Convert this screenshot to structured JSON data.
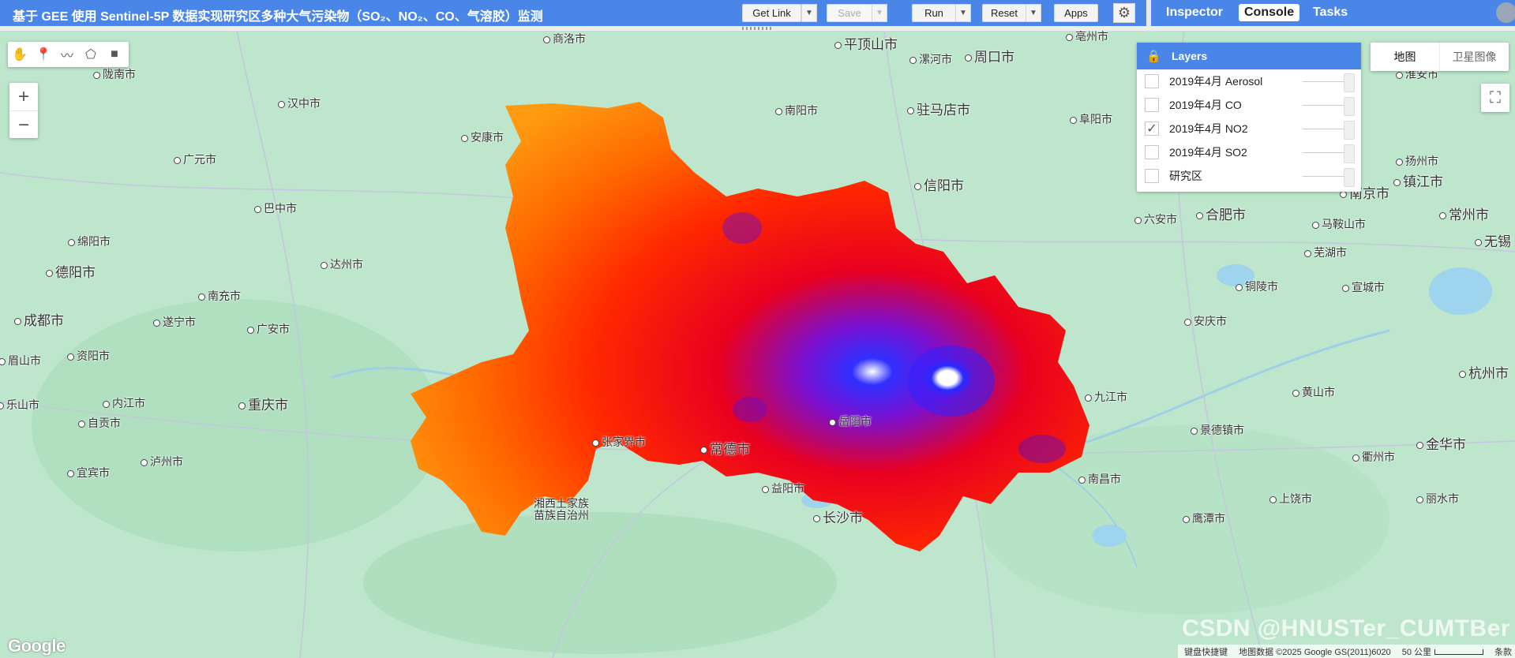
{
  "header": {
    "title": "基于 GEE 使用 Sentinel-5P 数据实现研究区多种大气污染物（SO₂、NO₂、CO、气溶胶）监测",
    "buttons": {
      "get_link": "Get Link",
      "save": "Save",
      "run": "Run",
      "reset": "Reset",
      "apps": "Apps"
    },
    "settings_icon": "gear-icon"
  },
  "right_tabs": [
    {
      "label": "Inspector",
      "active": false
    },
    {
      "label": "Console",
      "active": true
    },
    {
      "label": "Tasks",
      "active": false
    }
  ],
  "map": {
    "draw_tools": [
      "hand-icon",
      "marker-icon",
      "polyline-icon",
      "polygon-icon",
      "rectangle-icon"
    ],
    "zoom": {
      "in": "+",
      "out": "−"
    },
    "map_types": {
      "map": "地图",
      "satellite": "卫星图像"
    },
    "layers_panel": {
      "title": "Layers",
      "items": [
        {
          "label": "2019年4月 Aerosol",
          "checked": false
        },
        {
          "label": "2019年4月 CO",
          "checked": false
        },
        {
          "label": "2019年4月 NO2",
          "checked": true
        },
        {
          "label": "2019年4月 SO2",
          "checked": false
        },
        {
          "label": "研究区",
          "checked": false
        }
      ]
    },
    "cities": [
      {
        "name": "商洛市",
        "big": false
      },
      {
        "name": "平顶山市",
        "big": true
      },
      {
        "name": "漯河市",
        "big": false
      },
      {
        "name": "周口市",
        "big": true
      },
      {
        "name": "亳州市",
        "big": false
      },
      {
        "name": "陇南市",
        "big": false
      },
      {
        "name": "汉中市",
        "big": false
      },
      {
        "name": "南阳市",
        "big": false
      },
      {
        "name": "驻马店市",
        "big": true
      },
      {
        "name": "阜阳市",
        "big": false
      },
      {
        "name": "安康市",
        "big": false
      },
      {
        "name": "广元市",
        "big": false
      },
      {
        "name": "信阳市",
        "big": true
      },
      {
        "name": "巴中市",
        "big": false
      },
      {
        "name": "六安市",
        "big": false
      },
      {
        "name": "合肥市",
        "big": true
      },
      {
        "name": "绵阳市",
        "big": false
      },
      {
        "name": "达州市",
        "big": false
      },
      {
        "name": "德阳市",
        "big": true
      },
      {
        "name": "南充市",
        "big": false
      },
      {
        "name": "成都市",
        "big": true
      },
      {
        "name": "遂宁市",
        "big": false
      },
      {
        "name": "广安市",
        "big": false
      },
      {
        "name": "资阳市",
        "big": false
      },
      {
        "name": "眉山市",
        "big": false
      },
      {
        "name": "内江市",
        "big": false
      },
      {
        "name": "乐山市",
        "big": false
      },
      {
        "name": "重庆市",
        "big": true
      },
      {
        "name": "自贡市",
        "big": false
      },
      {
        "name": "泸州市",
        "big": false
      },
      {
        "name": "宜宾市",
        "big": false
      },
      {
        "name": "张家界市",
        "big": false
      },
      {
        "name": "常德市",
        "big": true
      },
      {
        "name": "岳阳市",
        "big": false
      },
      {
        "name": "益阳市",
        "big": false
      },
      {
        "name": "长沙市",
        "big": true
      },
      {
        "name": "湘西土家族",
        "big": false
      },
      {
        "name": "苗族自治州",
        "big": false
      },
      {
        "name": "九江市",
        "big": false
      },
      {
        "name": "安庆市",
        "big": false
      },
      {
        "name": "铜陵市",
        "big": false
      },
      {
        "name": "宣城市",
        "big": false
      },
      {
        "name": "芜湖市",
        "big": false
      },
      {
        "name": "马鞍山市",
        "big": false
      },
      {
        "name": "南京市",
        "big": true
      },
      {
        "name": "镇江市",
        "big": true
      },
      {
        "name": "扬州市",
        "big": false
      },
      {
        "name": "淮安市",
        "big": false
      },
      {
        "name": "常州市",
        "big": true
      },
      {
        "name": "无锡",
        "big": true
      },
      {
        "name": "杭州市",
        "big": true
      },
      {
        "name": "黄山市",
        "big": false
      },
      {
        "name": "景德镇市",
        "big": false
      },
      {
        "name": "衢州市",
        "big": false
      },
      {
        "name": "金华市",
        "big": true
      },
      {
        "name": "上饶市",
        "big": false
      },
      {
        "name": "丽水市",
        "big": false
      },
      {
        "name": "南昌市",
        "big": false
      },
      {
        "name": "鹰潭市",
        "big": false
      }
    ],
    "footer": {
      "keyboard": "键盘快捷键",
      "attribution": "地图数据 ©2025 Google GS(2011)6020",
      "scale": "50 公里",
      "terms": "条款"
    },
    "google_logo": "Google",
    "watermark": "CSDN @HNUSTer_CUMTBer"
  }
}
